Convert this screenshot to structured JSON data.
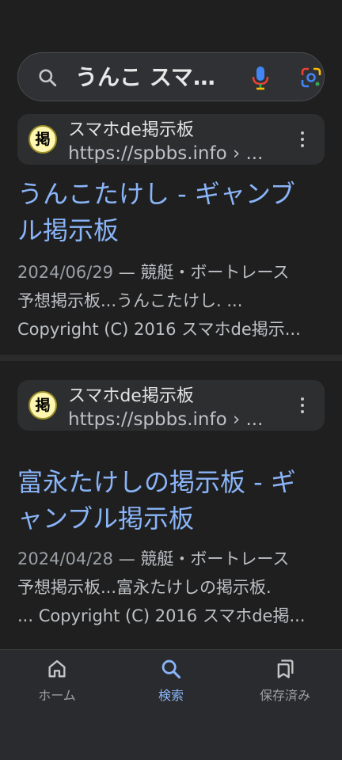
{
  "search": {
    "query": "うんこ スマ…",
    "search_icon": "search-icon",
    "mic_icon": "mic-icon",
    "lens_icon": "google-lens-icon"
  },
  "results": [
    {
      "favicon_char": "掲",
      "source_name": "スマホde掲示板",
      "source_url": "https://spbbs.info › ...",
      "title_lines": [
        "うんこたけし - ギャンブ",
        "ル掲示板"
      ],
      "date": "2024/06/29",
      "snippet_lines": [
        " — 競艇・ボートレース",
        "予想掲示板...うんこたけし. ...",
        "Copyright (C) 2016 スマホde掲示..."
      ]
    },
    {
      "favicon_char": "掲",
      "source_name": "スマホde掲示板",
      "source_url": "https://spbbs.info › ...",
      "title_lines": [
        "富永たけしの掲示板 - ギ",
        "ャンブル掲示板"
      ],
      "date": "2024/04/28",
      "snippet_lines": [
        " — 競艇・ボートレース",
        "予想掲示板...富永たけしの掲示板.",
        "... Copyright (C) 2016 スマホde掲..."
      ]
    }
  ],
  "nav": {
    "home_label": "ホーム",
    "search_label": "検索",
    "saved_label": "保存済み"
  },
  "colors": {
    "background": "#1f1f1f",
    "link": "#8ab4f8",
    "active_nav": "#8ab4f8"
  }
}
